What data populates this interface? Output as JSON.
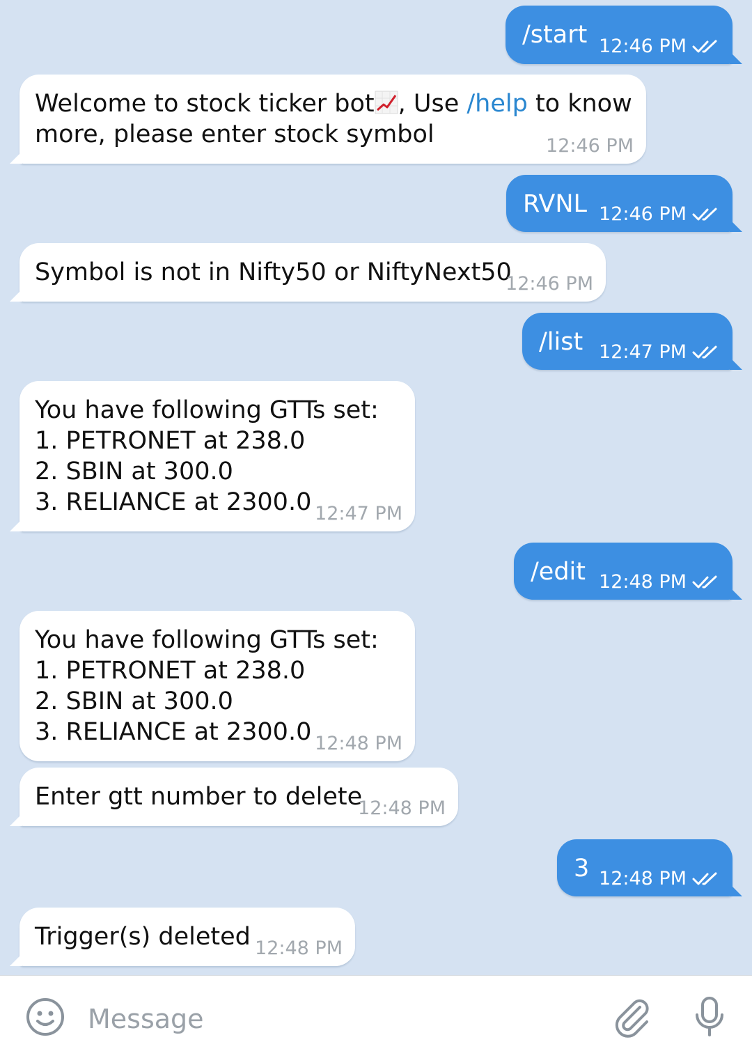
{
  "messages": [
    {
      "dir": "out",
      "text": "/start",
      "time": "12:46 PM"
    },
    {
      "dir": "in",
      "text_before": "Welcome to stock ticker bot",
      "icon": "chart-increasing-icon",
      "text_mid": ", Use ",
      "link": "/help",
      "text_after": " to know more, please enter stock symbol",
      "time": "12:46 PM"
    },
    {
      "dir": "out",
      "text": "RVNL",
      "time": "12:46 PM"
    },
    {
      "dir": "in",
      "text": "Symbol is not in Nifty50 or NiftyNext50",
      "time": "12:46 PM"
    },
    {
      "dir": "out",
      "text": "/list",
      "time": "12:47 PM"
    },
    {
      "dir": "in",
      "text": "You have following GTTs set:\n1. PETRONET at 238.0\n2. SBIN at 300.0\n3. RELIANCE at 2300.0",
      "time": "12:47 PM"
    },
    {
      "dir": "out",
      "text": "/edit",
      "time": "12:48 PM"
    },
    {
      "dir": "in",
      "text": "You have following GTTs set:\n1. PETRONET at 238.0\n2. SBIN at 300.0\n3. RELIANCE at 2300.0",
      "time": "12:48 PM"
    },
    {
      "dir": "in",
      "text": "Enter gtt number to delete",
      "time": "12:48 PM"
    },
    {
      "dir": "out",
      "text": "3",
      "time": "12:48 PM"
    },
    {
      "dir": "in",
      "text": "Trigger(s) deleted",
      "time": "12:48 PM"
    }
  ],
  "input": {
    "placeholder": "Message",
    "emoji_icon": "emoji-icon",
    "attach_icon": "paperclip-icon",
    "mic_icon": "microphone-icon"
  },
  "colors": {
    "background": "#d5e2f2",
    "outgoing_bubble": "#3d8fe2",
    "incoming_bubble": "#ffffff",
    "link": "#2a87d0",
    "timestamp_in": "#a2a8ae"
  }
}
